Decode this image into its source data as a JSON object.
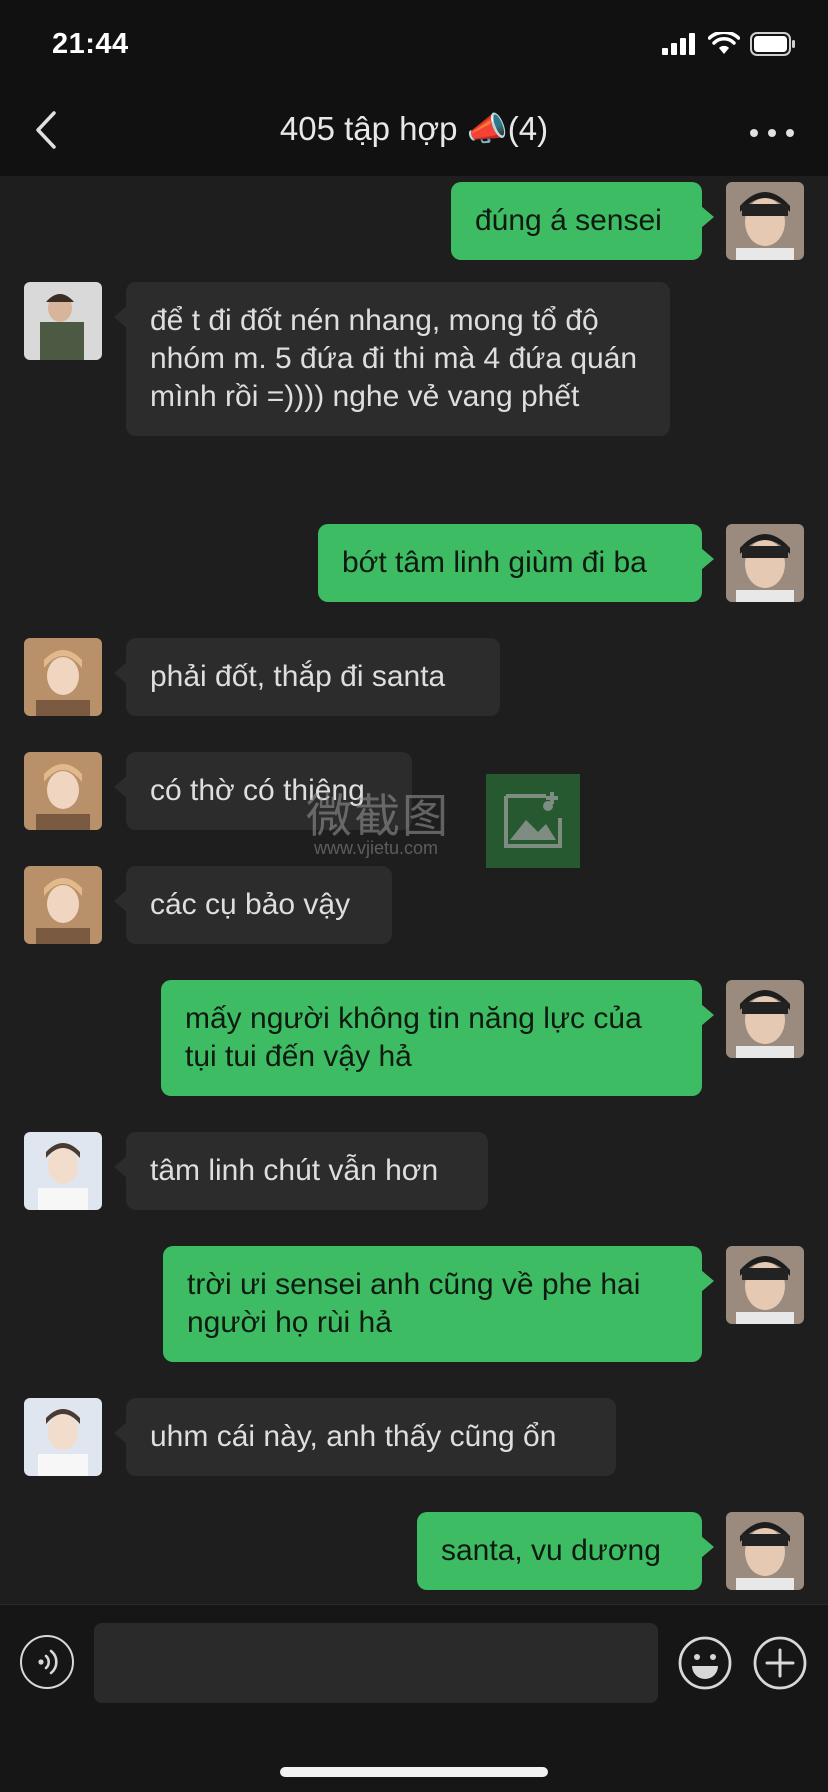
{
  "status_bar": {
    "time": "21:44"
  },
  "nav": {
    "title": "405 tập hợp 📣(4)"
  },
  "messages": [
    {
      "side": "mine",
      "text": "đúng á sensei",
      "avatar": "self"
    },
    {
      "side": "theirs",
      "text": "để t đi đốt nén nhang, mong tổ độ nhóm m. 5 đứa đi thi mà 4 đứa quán mình rồi =)))) nghe vẻ vang phết",
      "avatar": "member-a"
    },
    {
      "side": "mine",
      "text": "bớt tâm linh giùm đi ba",
      "avatar": "self"
    },
    {
      "side": "theirs",
      "text": "phải đốt, thắp đi santa",
      "avatar": "member-b"
    },
    {
      "side": "theirs",
      "text": "có thờ có thiêng",
      "avatar": "member-b"
    },
    {
      "side": "theirs",
      "text": "các cụ bảo vậy",
      "avatar": "member-b"
    },
    {
      "side": "mine",
      "text": "mấy người không tin năng lực của tụi tui đến vậy hả",
      "avatar": "self"
    },
    {
      "side": "theirs",
      "text": "tâm linh chút vẫn hơn",
      "avatar": "member-c"
    },
    {
      "side": "mine",
      "text": "trời ưi sensei anh cũng về phe hai người họ rùi hả",
      "avatar": "self"
    },
    {
      "side": "theirs",
      "text": "uhm cái này, anh thấy cũng ổn",
      "avatar": "member-c"
    },
    {
      "side": "mine",
      "text": "santa, vu dương",
      "avatar": "self"
    }
  ],
  "watermark": {
    "text": "微截图",
    "url": "www.vjietu.com"
  },
  "input": {
    "placeholder": ""
  },
  "colors": {
    "mine_bubble": "#3ebc64",
    "theirs_bubble": "#2c2c2c",
    "background": "#1e1e1e"
  }
}
